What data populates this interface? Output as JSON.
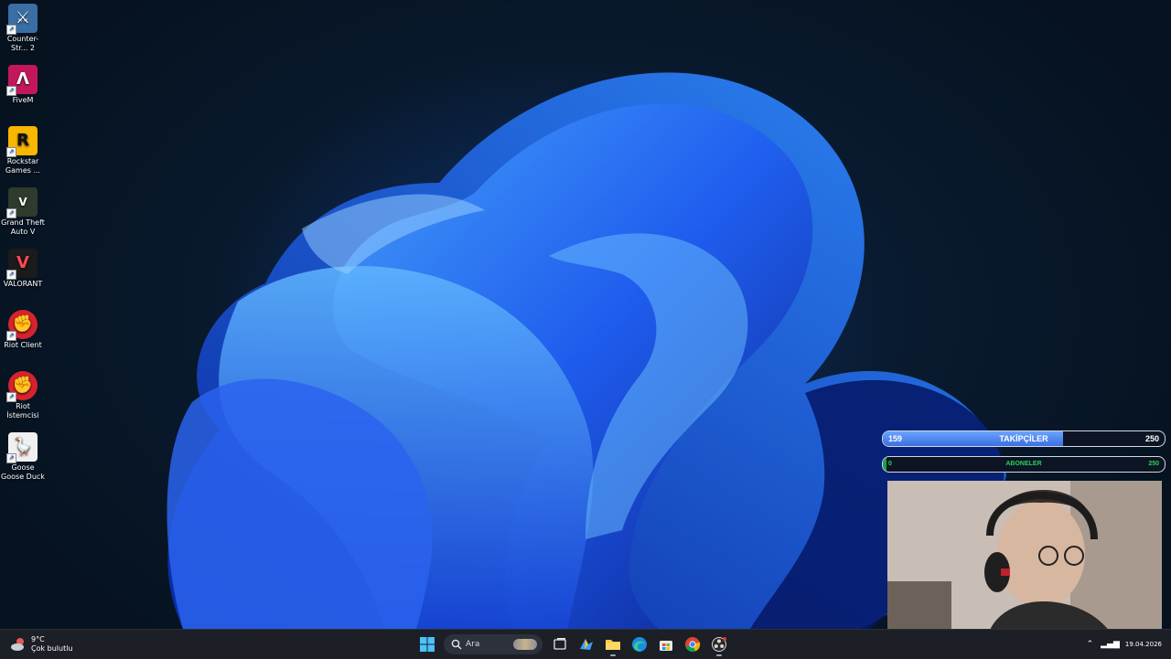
{
  "desktop": {
    "icons": [
      {
        "label": "Counter-Str... 2",
        "icon": "counter-strike-icon",
        "color": "#3a6ea5"
      },
      {
        "label": "FiveM",
        "icon": "fivem-icon",
        "color": "#c2185b"
      },
      {
        "label": "Rockstar Games ...",
        "icon": "rockstar-icon",
        "color": "#f7b600"
      },
      {
        "label": "Grand Theft Auto V",
        "icon": "gta-v-icon",
        "color": "#2f3b2c"
      },
      {
        "label": "VALORANT",
        "icon": "valorant-icon",
        "color": "#1b1b1b"
      },
      {
        "label": "Riot Client",
        "icon": "riot-client-icon",
        "color": "#d6232d"
      },
      {
        "label": "Riot İstemcisi",
        "icon": "riot-client-icon",
        "color": "#d6232d"
      },
      {
        "label": "Goose Goose Duck",
        "icon": "goose-goose-duck-icon",
        "color": "#f0f0f0"
      }
    ]
  },
  "overlay": {
    "followers": {
      "current": "159",
      "label": "TAKİPÇİLER",
      "goal": "250",
      "progress": 0.64
    },
    "subscribers": {
      "current": "0",
      "label": "ABONELER",
      "goal": "250",
      "progress": 0.0
    }
  },
  "taskbar": {
    "weather": {
      "temp": "9°C",
      "condition": "Çok bulutlu"
    },
    "search_placeholder": "Ara",
    "date": "19.04.2026",
    "pinned": [
      "start-icon",
      "search-icon",
      "task-view-icon",
      "widgets-icon",
      "file-explorer-icon",
      "edge-icon",
      "store-icon",
      "chrome-icon",
      "obs-icon"
    ]
  }
}
